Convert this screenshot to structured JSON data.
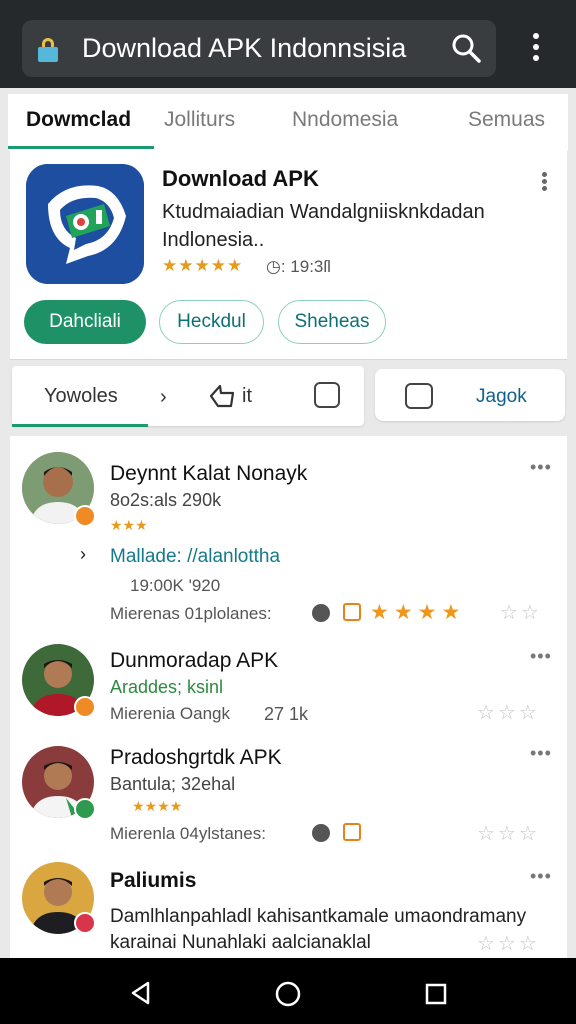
{
  "browser": {
    "url_text": "Download APK Indonnsisia"
  },
  "tabs": [
    {
      "label": "Dowmclad",
      "active": true
    },
    {
      "label": "Jolliturs",
      "active": false
    },
    {
      "label": "Nndomesia",
      "active": false
    },
    {
      "label": "Semuas",
      "active": false
    }
  ],
  "app": {
    "title": "Download APK",
    "description": "Ktudmaiadian Wandalgniisknkdadan Indlonesia..",
    "rating_stars": "★★★★★",
    "meta": "◷: 19:3ſl",
    "buttons": {
      "primary": "Dahcliali",
      "secondary": "Heckdul",
      "tertiary": "Sheheas"
    },
    "accent_color": "#1f9166"
  },
  "actions": {
    "left_label": "Yowoles",
    "chevron": "›",
    "it_label": "it",
    "right_label": "Jagok"
  },
  "reviews": [
    {
      "name": "Deynnt Kalat Nonayk",
      "sub": "8o2s:als 290k",
      "stars": "★★★",
      "link": "Mallade: //alanlottha",
      "stat": "19:00K   '920",
      "meta": "Mierenas  01plolanes:",
      "rating_filled": "★★★★",
      "rating_empty": "☆☆"
    },
    {
      "name": "Dunmoradap APK",
      "sub": "Araddes; ksinl",
      "meta": "Mierenia Oangk",
      "count": "27 1k",
      "rating_empty": "☆☆☆"
    },
    {
      "name": "Pradoshgrtdk APK",
      "sub": "Bantula; 32ehal",
      "stars": "★★★★",
      "meta": "Mierenla  04ylstanes:",
      "rating_empty": "☆☆☆"
    },
    {
      "name": "Paliumis",
      "line1": "Damlhlanpahladl kahisantkamale umaondramany",
      "line2": "karainai Nunahlaki aalcianaklal",
      "rating_empty": "☆☆☆"
    }
  ],
  "more_label": "•••"
}
